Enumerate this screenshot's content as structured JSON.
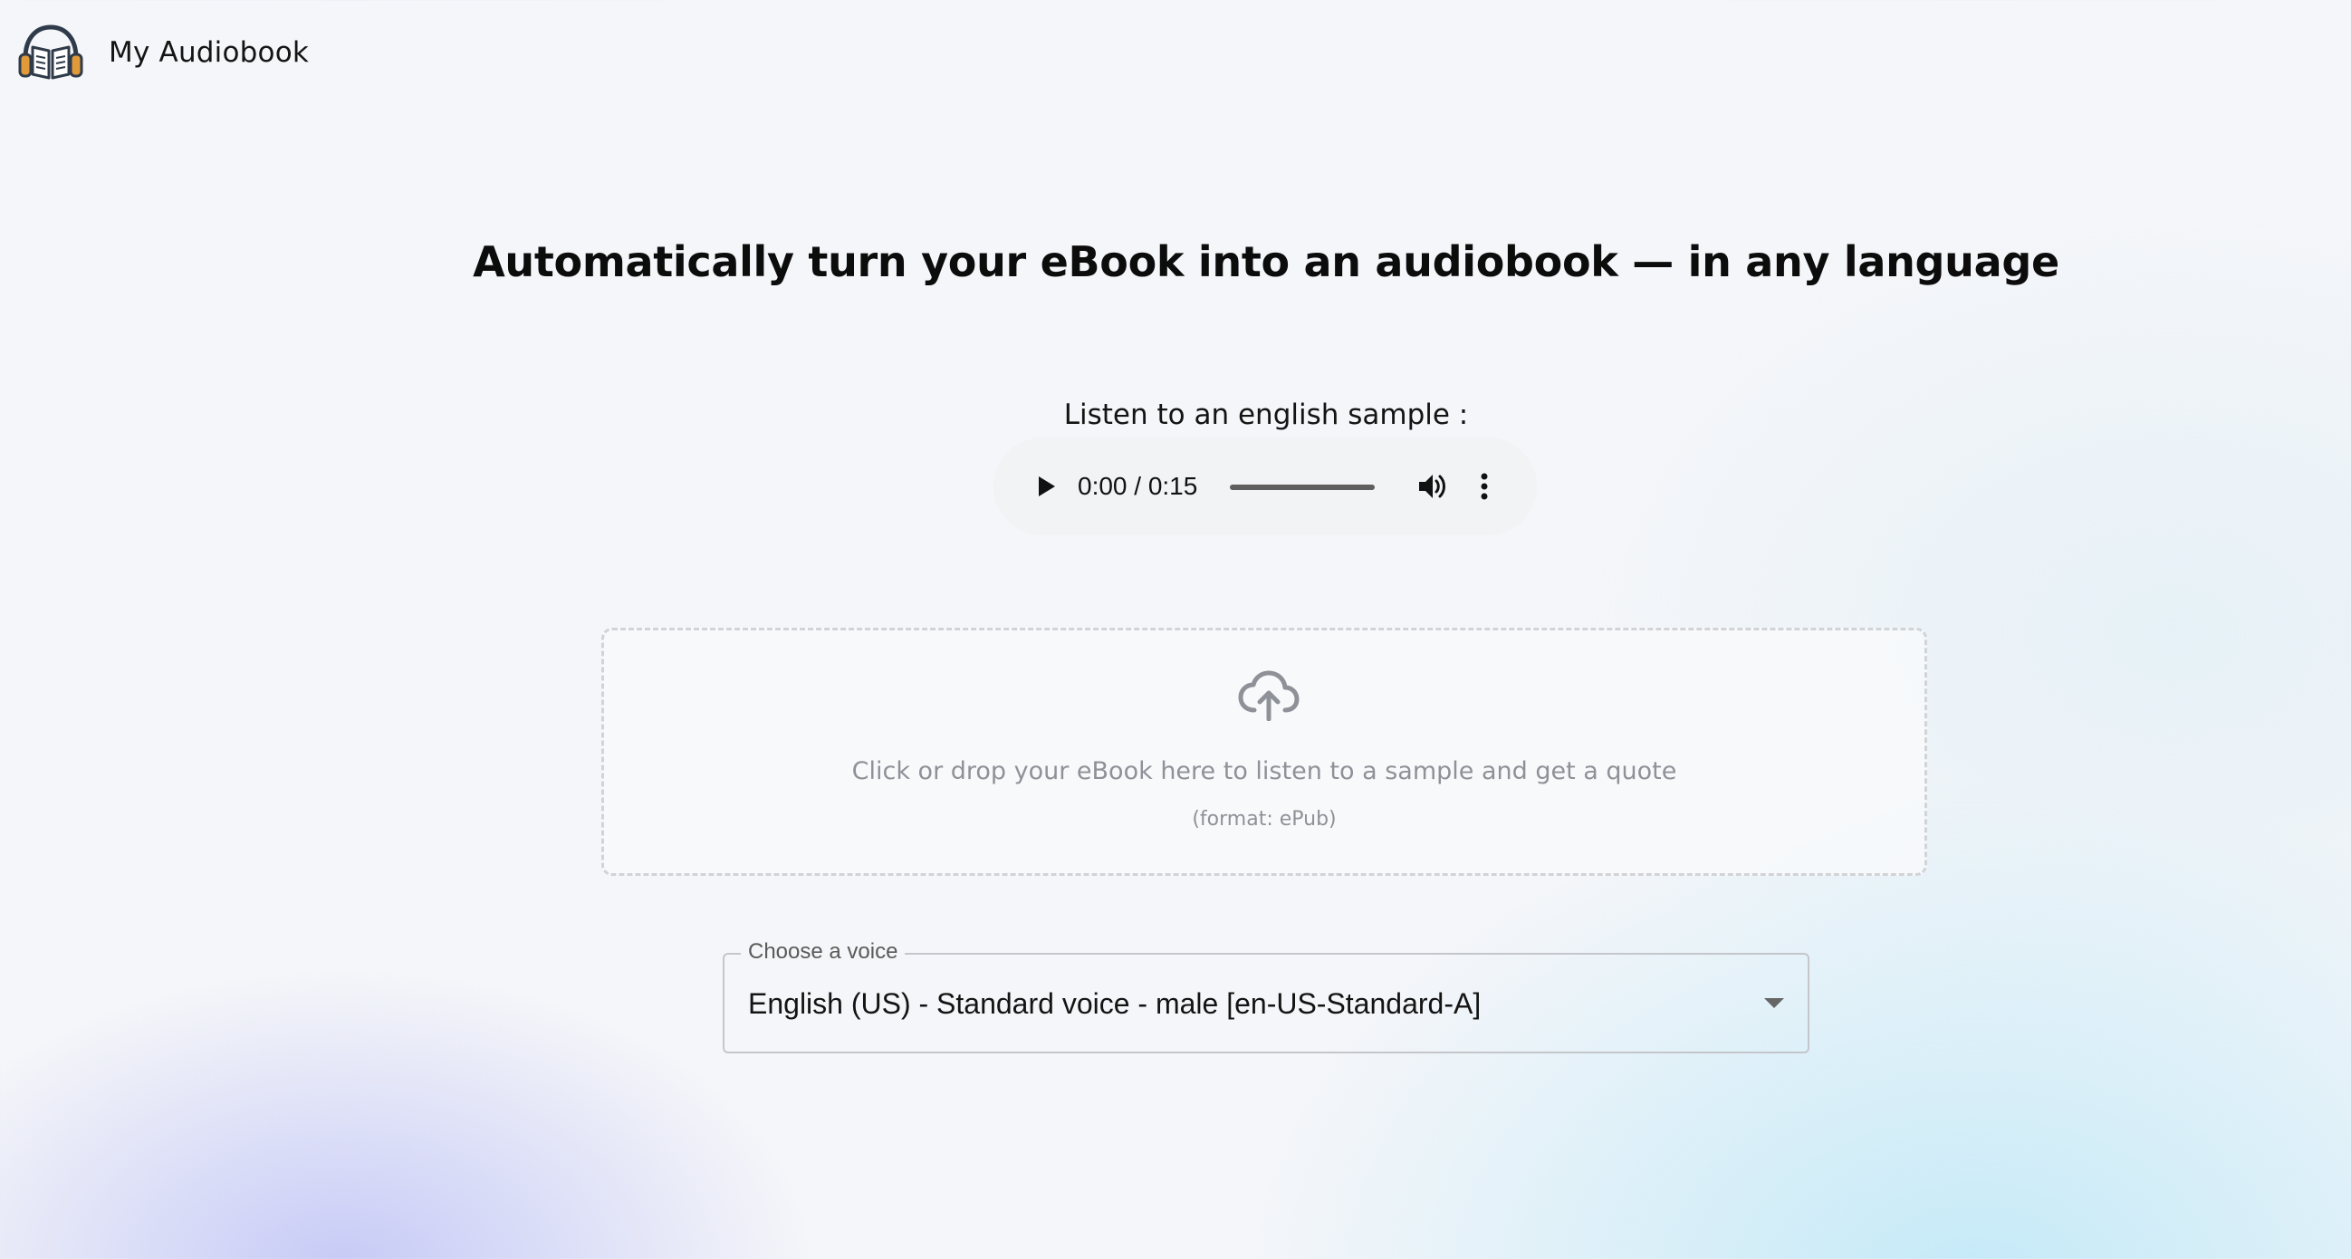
{
  "header": {
    "app_title": "My Audiobook",
    "logo_icon": "headphones-book-icon"
  },
  "hero": {
    "title": "Automatically turn your eBook into an audiobook — in any language"
  },
  "sample": {
    "label": "Listen to an english sample :",
    "player": {
      "time": "0:00 / 0:15",
      "progress_fraction": 0,
      "icons": [
        "play-icon",
        "volume-icon",
        "more-options-icon"
      ]
    }
  },
  "dropzone": {
    "icon": "cloud-upload-icon",
    "text": "Click or drop your eBook here to listen to a sample and get a quote",
    "format": "(format: ePub)"
  },
  "voice_select": {
    "label": "Choose a voice",
    "value": "English (US) - Standard voice - male [en-US-Standard-A]"
  },
  "colors": {
    "background": "#f5f6f9",
    "logo_dark": "#2f3b4a",
    "logo_accent": "#e09a3a",
    "muted_text": "#8e9197"
  }
}
